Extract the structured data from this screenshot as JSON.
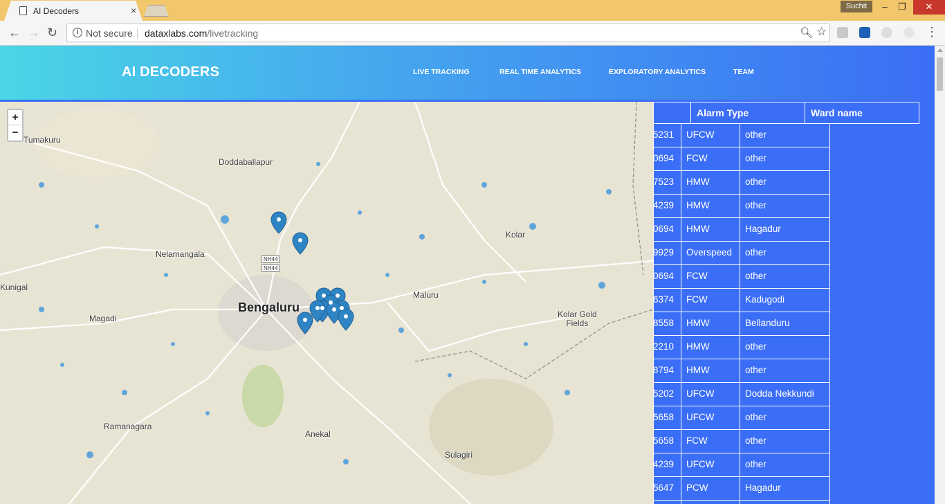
{
  "browser": {
    "tab_title": "AI Decoders",
    "tab_close": "×",
    "user": "Suchit",
    "url_secure_label": "Not secure",
    "url_host": "dataxlabs.com",
    "url_path": "/livetracking"
  },
  "site": {
    "brand": "AI DECODERS",
    "nav": [
      "LIVE TRACKING",
      "REAL TIME ANALYTICS",
      "EXPLORATORY ANALYTICS",
      "TEAM"
    ]
  },
  "map": {
    "zoom_in": "+",
    "zoom_out": "−",
    "places": {
      "tumakuru": "Tumakuru",
      "doddaballapur": "Doddaballapur",
      "nelamangala": "Nelamangala",
      "kunigal": "Kunigal",
      "bengaluru": "Bengaluru",
      "kolar": "Kolar",
      "maluru": "Maluru",
      "magadi": "Magadi",
      "kolar_gold_fields": "Kolar Gold\nFields",
      "ramanagara": "Ramanagara",
      "anekal": "Anekal",
      "sulagiri": "Sulagiri"
    },
    "highway": "NH44",
    "marker_color": "#2f84c4"
  },
  "table": {
    "headers": [
      "",
      "Alarm Type",
      "Ward name"
    ],
    "rows": [
      {
        "id": "5231",
        "type": "UFCW",
        "ward": "other"
      },
      {
        "id": "0694",
        "type": "FCW",
        "ward": "other"
      },
      {
        "id": "7523",
        "type": "HMW",
        "ward": "other"
      },
      {
        "id": "4239",
        "type": "HMW",
        "ward": "other"
      },
      {
        "id": "0694",
        "type": "HMW",
        "ward": "Hagadur"
      },
      {
        "id": "9929",
        "type": "Overspeed",
        "ward": "other"
      },
      {
        "id": "0694",
        "type": "FCW",
        "ward": "other"
      },
      {
        "id": "6374",
        "type": "FCW",
        "ward": "Kadugodi"
      },
      {
        "id": "8558",
        "type": "HMW",
        "ward": "Bellanduru"
      },
      {
        "id": "2210",
        "type": "HMW",
        "ward": "other"
      },
      {
        "id": "8794",
        "type": "HMW",
        "ward": "other"
      },
      {
        "id": "5202",
        "type": "UFCW",
        "ward": "Dodda Nekkundi"
      },
      {
        "id": "5658",
        "type": "UFCW",
        "ward": "other"
      },
      {
        "id": "5658",
        "type": "FCW",
        "ward": "other"
      },
      {
        "id": "4239",
        "type": "UFCW",
        "ward": "other"
      },
      {
        "id": "5647",
        "type": "PCW",
        "ward": "Hagadur"
      },
      {
        "id": "",
        "type": "",
        "ward": ""
      }
    ]
  },
  "colors": {
    "titlebar": "#f2c76b",
    "page_bg": "#3b6ef6",
    "gradient_start": "#4ad6e6"
  }
}
